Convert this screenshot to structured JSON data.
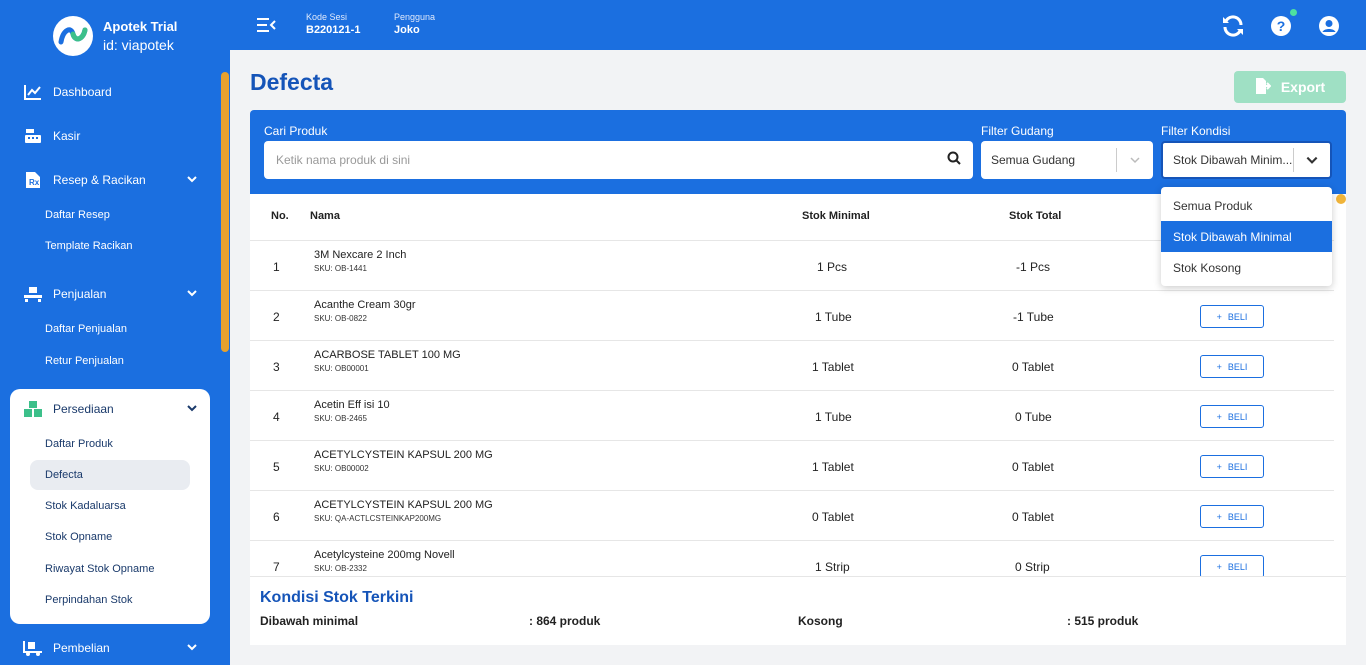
{
  "brand": {
    "name": "Apotek Trial",
    "id": "id: viapotek"
  },
  "sidebar": {
    "items": [
      {
        "label": "Dashboard"
      },
      {
        "label": "Kasir"
      },
      {
        "label": "Resep & Racikan",
        "subs": [
          "Daftar Resep",
          "Template Racikan"
        ]
      },
      {
        "label": "Penjualan",
        "subs": [
          "Daftar Penjualan",
          "Retur Penjualan"
        ]
      },
      {
        "label": "Persediaan",
        "subs": [
          "Daftar Produk",
          "Defecta",
          "Stok Kadaluarsa",
          "Stok Opname",
          "Riwayat Stok Opname",
          "Perpindahan Stok"
        ]
      },
      {
        "label": "Pembelian"
      }
    ]
  },
  "topbar": {
    "session_label": "Kode Sesi",
    "session_value": "B220121-1",
    "user_label": "Pengguna",
    "user_value": "Joko"
  },
  "page": {
    "title": "Defecta",
    "export_label": "Export"
  },
  "filters": {
    "search_label": "Cari Produk",
    "search_placeholder": "Ketik nama produk di sini",
    "gudang_label": "Filter Gudang",
    "gudang_value": "Semua Gudang",
    "kondisi_label": "Filter Kondisi",
    "kondisi_value": "Stok Dibawah Minim...",
    "kondisi_options": [
      "Semua Produk",
      "Stok Dibawah Minimal",
      "Stok Kosong"
    ]
  },
  "table": {
    "headers": {
      "no": "No.",
      "nama": "Nama",
      "stok_min": "Stok Minimal",
      "stok_total": "Stok Total"
    },
    "beli_label": "BELI",
    "rows": [
      {
        "no": "1",
        "name": "3M Nexcare 2 Inch",
        "sku": "SKU: OB-1441",
        "min": "1 Pcs",
        "total": "-1 Pcs"
      },
      {
        "no": "2",
        "name": "Acanthe Cream 30gr",
        "sku": "SKU: OB-0822",
        "min": "1 Tube",
        "total": "-1 Tube"
      },
      {
        "no": "3",
        "name": "ACARBOSE TABLET 100 MG",
        "sku": "SKU: OB00001",
        "min": "1 Tablet",
        "total": "0 Tablet"
      },
      {
        "no": "4",
        "name": "Acetin Eff isi 10",
        "sku": "SKU: OB-2465",
        "min": "1 Tube",
        "total": "0 Tube"
      },
      {
        "no": "5",
        "name": "ACETYLCYSTEIN KAPSUL 200 MG",
        "sku": "SKU: OB00002",
        "min": "1 Tablet",
        "total": "0 Tablet"
      },
      {
        "no": "6",
        "name": "ACETYLCYSTEIN KAPSUL 200 MG",
        "sku": "SKU: QA-ACTLCSTEINKAP200MG",
        "min": "0 Tablet",
        "total": "0 Tablet"
      },
      {
        "no": "7",
        "name": "Acetylcysteine 200mg Novell",
        "sku": "SKU: OB-2332",
        "min": "1 Strip",
        "total": "0 Strip"
      }
    ]
  },
  "summary": {
    "title": "Kondisi Stok Terkini",
    "below_label": "Dibawah minimal",
    "below_value": ": 864 produk",
    "empty_label": "Kosong",
    "empty_value": ": 515 produk"
  },
  "colors": {
    "primary": "#1b6fe0",
    "title": "#1554b8",
    "export": "#9fe0c4",
    "scroll": "#e7a12e"
  }
}
